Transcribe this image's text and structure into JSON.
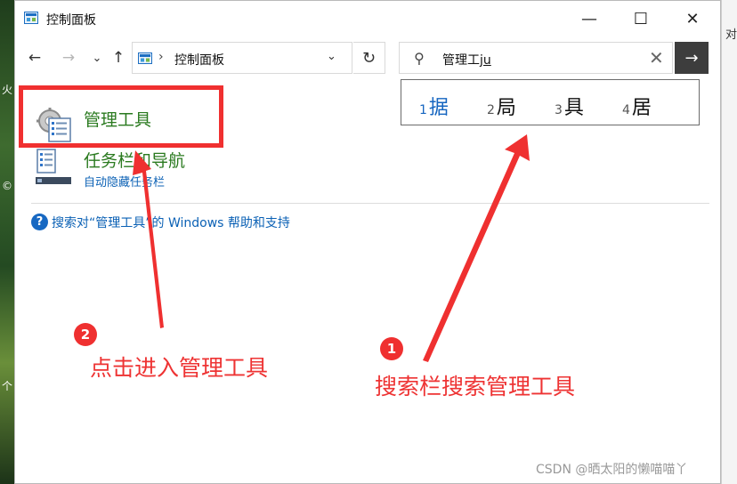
{
  "window": {
    "title": "控制面板",
    "minimize_glyph": "—",
    "maximize_glyph": "☐",
    "close_glyph": "✕"
  },
  "nav": {
    "back_glyph": "←",
    "forward_glyph": "→",
    "recent_glyph": "⌄",
    "up_glyph": "↑"
  },
  "address": {
    "chevron": "›",
    "path": "控制面板",
    "dropdown_glyph": "⌄",
    "refresh_glyph": "↻"
  },
  "search": {
    "query": "管理工",
    "composition": "ju",
    "icon": "search-icon",
    "clear_glyph": "✕",
    "go_glyph": "→"
  },
  "ime_candidates": [
    {
      "num": "1",
      "text": "据"
    },
    {
      "num": "2",
      "text": "局"
    },
    {
      "num": "3",
      "text": "具"
    },
    {
      "num": "4",
      "text": "居"
    }
  ],
  "results": [
    {
      "title": "管理工具",
      "subtitle": ""
    },
    {
      "title": "任务栏和导航",
      "subtitle": "自动隐藏任务栏"
    }
  ],
  "help": {
    "glyph": "?",
    "text": "搜索对“管理工具”的 Windows 帮助和支持"
  },
  "annotations": {
    "step1_badge": "1",
    "step1_text": "搜索栏搜索管理工具",
    "step2_badge": "2",
    "step2_text": "点击进入管理工具",
    "color": "#ee3333"
  },
  "edge": {
    "right_text": "对",
    "left_glyphs": [
      "火",
      "©",
      "个"
    ]
  },
  "watermark": "CSDN @晒太阳的懒喵喵丫"
}
